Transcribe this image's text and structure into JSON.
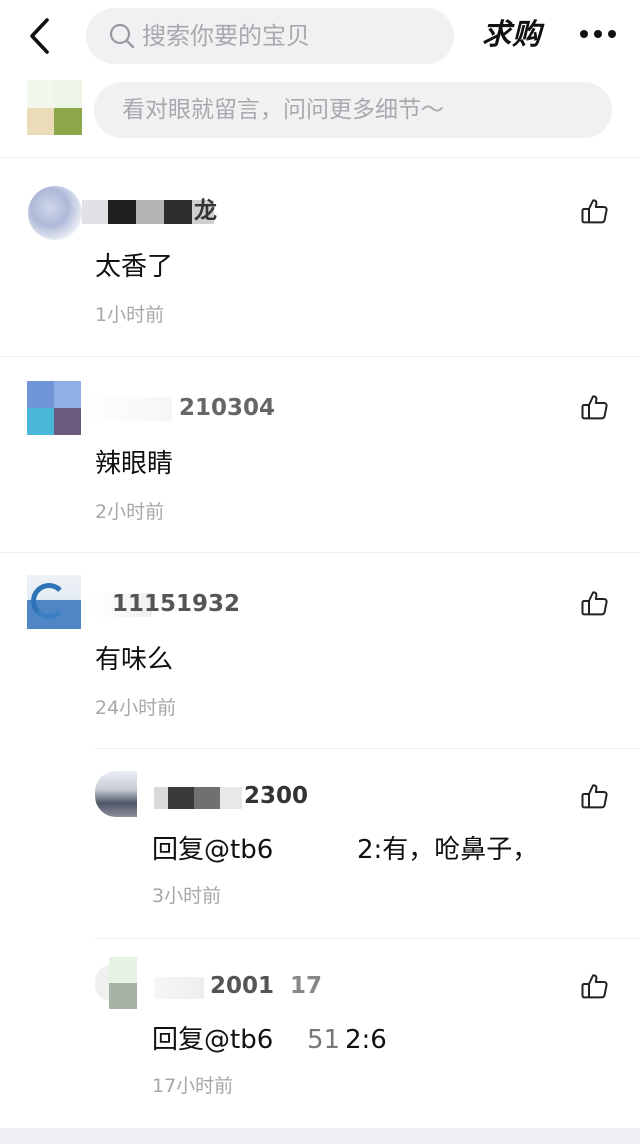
{
  "search": {
    "placeholder": "搜索你要的宝贝"
  },
  "header": {
    "title": "求购"
  },
  "comment_input": {
    "placeholder": "看对眼就留言，问问更多细节～"
  },
  "comments": [
    {
      "name": "龙",
      "text": "太香了",
      "time": "1小时前"
    },
    {
      "name": "210304",
      "text": "辣眼睛",
      "time": "2小时前"
    },
    {
      "name": "11151932",
      "text": "有味么",
      "time": "24小时前",
      "replies": [
        {
          "name": "2300",
          "text": "回复@tb6",
          "text2": "2:有，呛鼻子，",
          "time": "3小时前"
        },
        {
          "name": "2001",
          "name_suffix": "17",
          "text": "回复@tb6",
          "text2": "51",
          "text3": "2:6",
          "time": "17小时前"
        }
      ]
    }
  ],
  "icons": {
    "back": "chevron-left-icon",
    "search": "search-icon",
    "more": "more-dots-icon",
    "like": "thumbs-up-icon"
  }
}
